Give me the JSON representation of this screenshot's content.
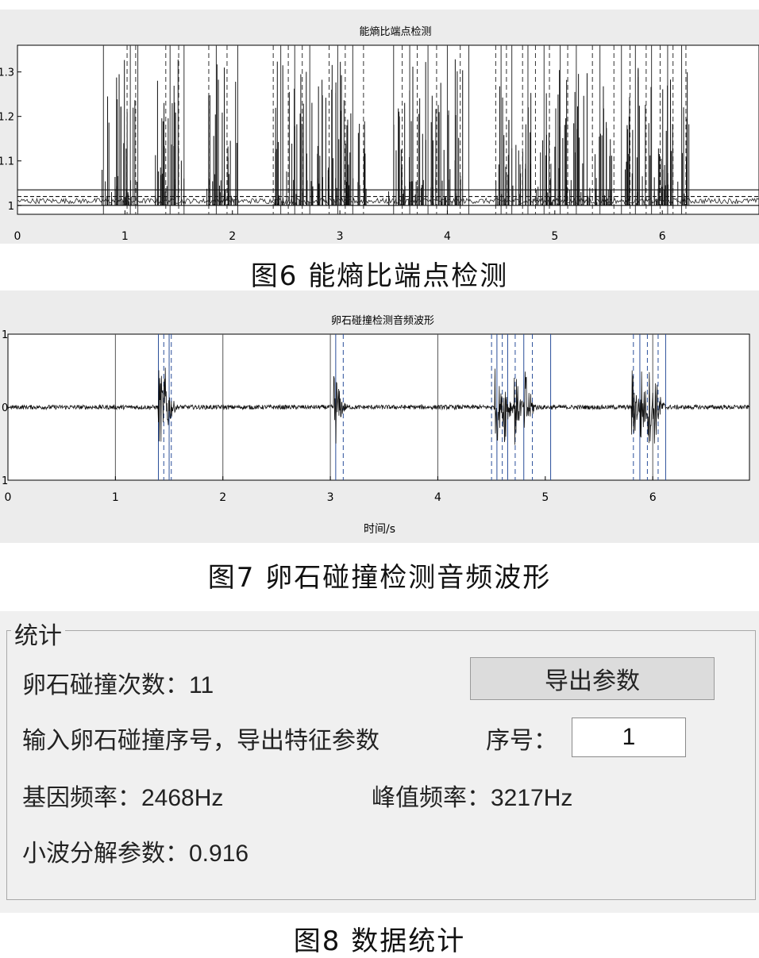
{
  "figure6": {
    "plot_title": "能熵比端点检测",
    "caption": "图6 能熵比端点检测"
  },
  "figure7": {
    "plot_title": "卵石碰撞检测音频波形",
    "xlabel": "时间/s",
    "caption": "图7 卵石碰撞检测音频波形"
  },
  "figure8": {
    "caption": "图8 数据统计"
  },
  "stats": {
    "legend": "统计",
    "collision_count_label": "卵石碰撞次数：",
    "collision_count_value": "11",
    "export_button_label": "导出参数",
    "instruction_text": "输入卵石碰撞序号，导出特征参数",
    "index_label": "序号：",
    "index_value": "1",
    "fundamental_freq_label": "基因频率：",
    "fundamental_freq_value": "2468Hz",
    "peak_freq_label": "峰值频率：",
    "peak_freq_value": "3217Hz",
    "wavelet_param_label": "小波分解参数：",
    "wavelet_param_value": "0.916"
  },
  "chart_data": [
    {
      "type": "line",
      "title": "能熵比端点检测",
      "xlabel": "",
      "ylabel": "",
      "xlim": [
        0,
        6.9
      ],
      "ylim": [
        0.98,
        1.36
      ],
      "x_ticks": [
        "0",
        "1",
        "2",
        "3",
        "4",
        "5",
        "6"
      ],
      "y_ticks": [
        "1",
        "1.1",
        "1.2",
        "1.3"
      ],
      "thresholds": [
        1.0,
        1.02,
        1.035
      ],
      "burst_regions": [
        [
          0.78,
          1.12
        ],
        [
          1.28,
          1.55
        ],
        [
          1.75,
          2.05
        ],
        [
          2.38,
          3.25
        ],
        [
          3.45,
          4.15
        ],
        [
          4.45,
          5.55
        ],
        [
          5.65,
          6.25
        ]
      ],
      "detect_lines": [
        0.8,
        1.02,
        1.05,
        1.1,
        1.12,
        1.38,
        1.42,
        1.5,
        1.55,
        1.78,
        1.85,
        1.95,
        2.05,
        2.38,
        2.45,
        2.52,
        2.58,
        2.65,
        2.72,
        2.9,
        2.98,
        3.05,
        3.12,
        3.22,
        3.5,
        3.58,
        3.65,
        3.72,
        3.82,
        3.9,
        4.0,
        4.12,
        4.2,
        4.45,
        4.5,
        4.55,
        4.6,
        4.7,
        4.75,
        4.82,
        4.9,
        4.95,
        5.05,
        5.12,
        5.2,
        5.35,
        5.42,
        5.55,
        5.62,
        5.7,
        5.75,
        5.85,
        5.9,
        5.98,
        6.05,
        6.1,
        6.18,
        6.22
      ]
    },
    {
      "type": "line",
      "title": "卵石碰撞检测音频波形",
      "xlabel": "时间/s",
      "ylabel": "",
      "xlim": [
        0,
        6.9
      ],
      "ylim": [
        -1,
        1
      ],
      "x_ticks": [
        "0",
        "1",
        "2",
        "3",
        "4",
        "5",
        "6"
      ],
      "y_ticks": [
        "1",
        "0",
        "1"
      ],
      "events": [
        1.42,
        1.47,
        3.05,
        4.55,
        4.62,
        4.72,
        4.82,
        5.82,
        5.9,
        5.97,
        6.02
      ],
      "markers": [
        1.0,
        1.4,
        1.45,
        1.5,
        1.52,
        2.0,
        3.0,
        3.05,
        3.12,
        4.0,
        4.5,
        4.55,
        4.6,
        4.65,
        4.72,
        4.8,
        4.88,
        5.05,
        5.82,
        5.88,
        5.95,
        6.0,
        6.05,
        6.12
      ]
    }
  ]
}
